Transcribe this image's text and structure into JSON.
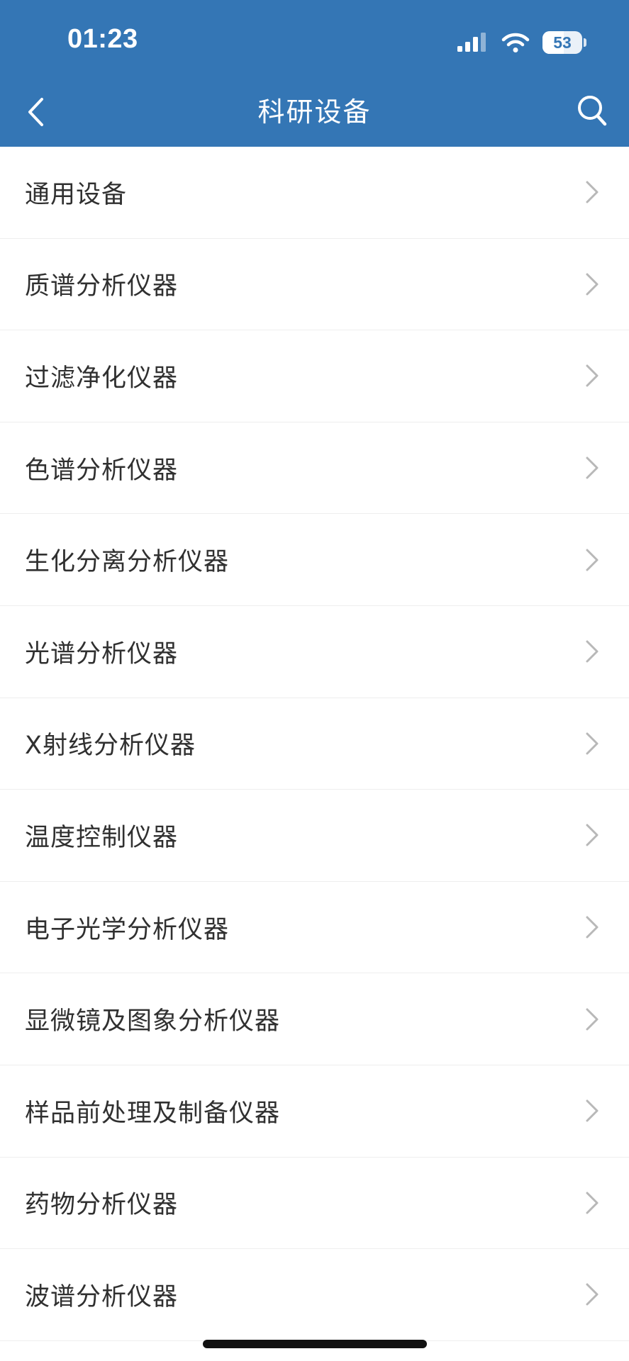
{
  "status_bar": {
    "time": "01:23",
    "battery": "53",
    "battery_level": 0.53
  },
  "nav": {
    "title": "科研设备",
    "back_icon": "chevron-left-icon",
    "search_icon": "search-icon"
  },
  "categories": [
    {
      "label": "通用设备"
    },
    {
      "label": "质谱分析仪器"
    },
    {
      "label": "过滤净化仪器"
    },
    {
      "label": "色谱分析仪器"
    },
    {
      "label": "生化分离分析仪器"
    },
    {
      "label": "光谱分析仪器"
    },
    {
      "label": "X射线分析仪器"
    },
    {
      "label": "温度控制仪器"
    },
    {
      "label": "电子光学分析仪器"
    },
    {
      "label": "显微镜及图象分析仪器"
    },
    {
      "label": "样品前处理及制备仪器"
    },
    {
      "label": "药物分析仪器"
    },
    {
      "label": "波谱分析仪器"
    }
  ],
  "colors": {
    "header": "#3476b5",
    "row_text": "#303030",
    "chevron": "#b8b8b8",
    "divider": "#eeeeee"
  }
}
